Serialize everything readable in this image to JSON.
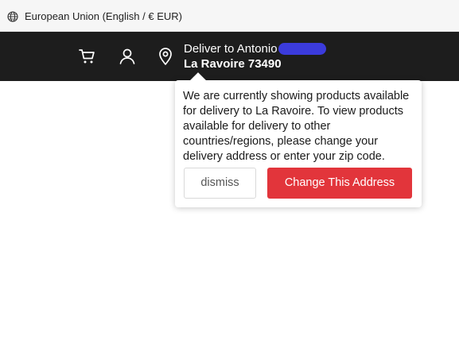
{
  "topbar": {
    "region_label": "European Union (English / € EUR)",
    "icon": "globe-icon"
  },
  "navbar": {
    "icons": [
      "cart-icon",
      "account-icon",
      "location-pin-icon"
    ],
    "deliver_prefix": "Deliver to Antonio",
    "deliver_address": "La Ravoire 73490"
  },
  "popover": {
    "message": "We are currently showing products available for delivery to La Ravoire. To view products available for delivery to other countries/regions, please change your delivery address or enter your zip code.",
    "dismiss_label": "dismiss",
    "change_label": "Change This Address"
  },
  "colors": {
    "navbar_bg": "#1d1d1d",
    "accent_red": "#e2353b",
    "redaction": "#3b3bdc"
  }
}
